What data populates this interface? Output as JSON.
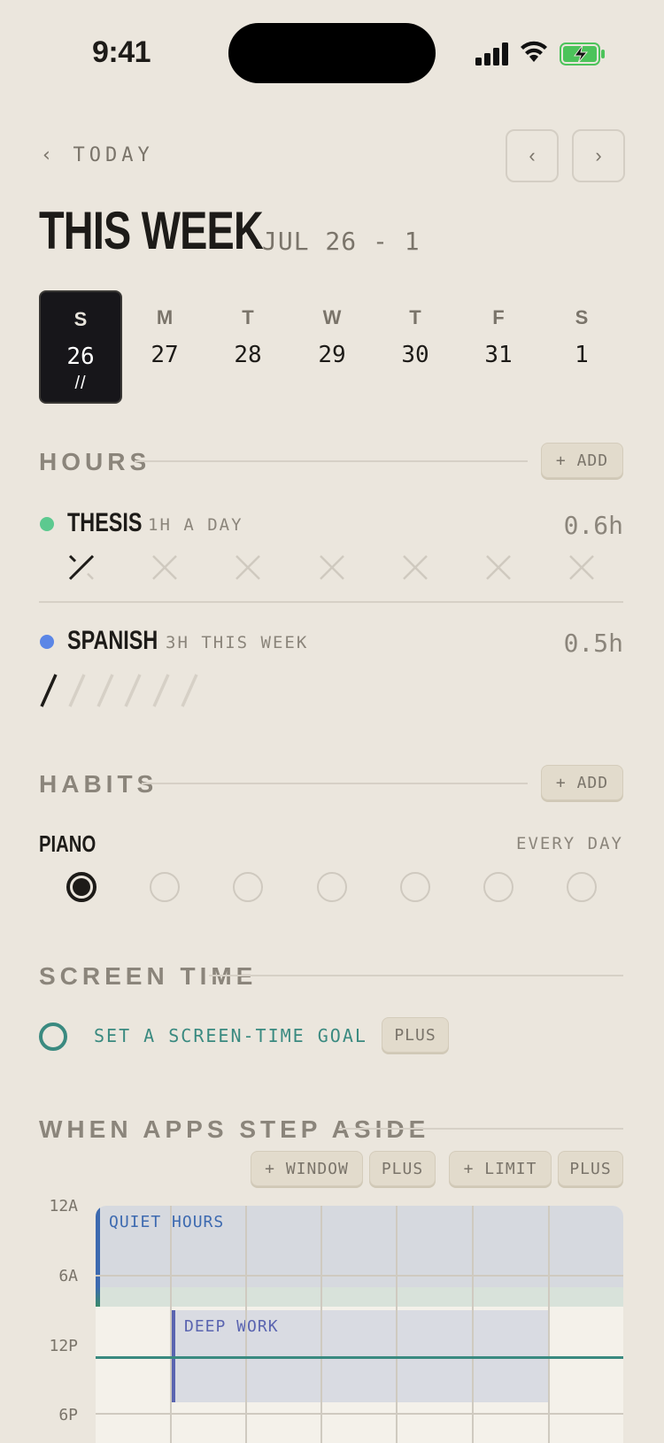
{
  "status": {
    "time": "9:41"
  },
  "nav": {
    "back_label": "‹ TODAY",
    "prev_label": "‹",
    "next_label": "›"
  },
  "header": {
    "title": "THIS WEEK",
    "range": "JUL 26 - 1"
  },
  "week": [
    {
      "letter": "S",
      "num": "26",
      "mark": "//"
    },
    {
      "letter": "M",
      "num": "27"
    },
    {
      "letter": "T",
      "num": "28"
    },
    {
      "letter": "W",
      "num": "29"
    },
    {
      "letter": "T",
      "num": "30"
    },
    {
      "letter": "F",
      "num": "31"
    },
    {
      "letter": "S",
      "num": "1"
    }
  ],
  "hours": {
    "label": "HOURS",
    "add_label": "+ ADD",
    "items": [
      {
        "name": "THESIS",
        "sub": "1H A DAY",
        "value": "0.6h",
        "color": "#5cc98f"
      },
      {
        "name": "SPANISH",
        "sub": "3H THIS WEEK",
        "value": "0.5h",
        "color": "#5b86e6"
      }
    ]
  },
  "habits": {
    "label": "HABITS",
    "add_label": "+ ADD",
    "items": [
      {
        "name": "PIANO",
        "freq": "EVERY DAY"
      }
    ]
  },
  "screen_time": {
    "label": "SCREEN TIME",
    "goal_label": "SET A SCREEN-TIME GOAL ›",
    "plus_label": "PLUS"
  },
  "apps": {
    "label": "WHEN APPS STEP ASIDE",
    "window_label": "+ WINDOW",
    "limit_label": "+ LIMIT",
    "plus_label": "PLUS",
    "hours": [
      "12A",
      "6A",
      "12P",
      "6P"
    ],
    "blocks": [
      {
        "name": "QUIET HOURS",
        "color": "#3d6ab0"
      },
      {
        "name": "DEEP WORK",
        "color": "#5a64b0"
      }
    ]
  },
  "colors": {
    "accent_teal": "#3a8a80",
    "bg": "#ebe6dd",
    "dark": "#17161a"
  }
}
